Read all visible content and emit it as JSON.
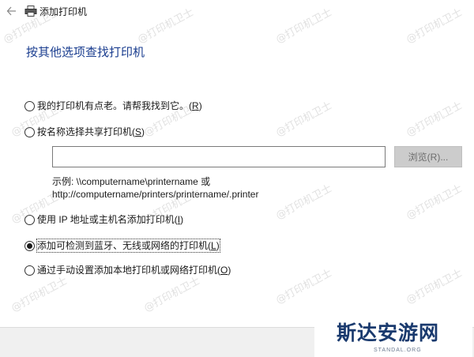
{
  "window": {
    "title": "添加打印机",
    "back_icon": "arrow-left-icon",
    "printer_icon": "printer-icon"
  },
  "heading": "按其他选项查找打印机",
  "options": [
    {
      "label": "我的打印机有点老。请帮我找到它。",
      "hotkey": "R",
      "checked": false
    },
    {
      "label": "按名称选择共享打印机",
      "hotkey": "S",
      "checked": false
    },
    {
      "label": "使用 IP 地址或主机名添加打印机",
      "hotkey": "I",
      "checked": false
    },
    {
      "label": "添加可检测到蓝牙、无线或网络的打印机",
      "hotkey": "L",
      "checked": true
    },
    {
      "label": "通过手动设置添加本地打印机或网络打印机",
      "hotkey": "O",
      "checked": false
    }
  ],
  "shared_printer": {
    "value": "",
    "browse_label": "浏览(R)...",
    "example_line1": "示例: \\\\computername\\printername 或",
    "example_line2": "http://computername/printers/printername/.printer"
  },
  "watermark_text": "@打印机卫士",
  "logo": {
    "main": "斯达安游网",
    "sub": "STANDAL.ORG"
  }
}
